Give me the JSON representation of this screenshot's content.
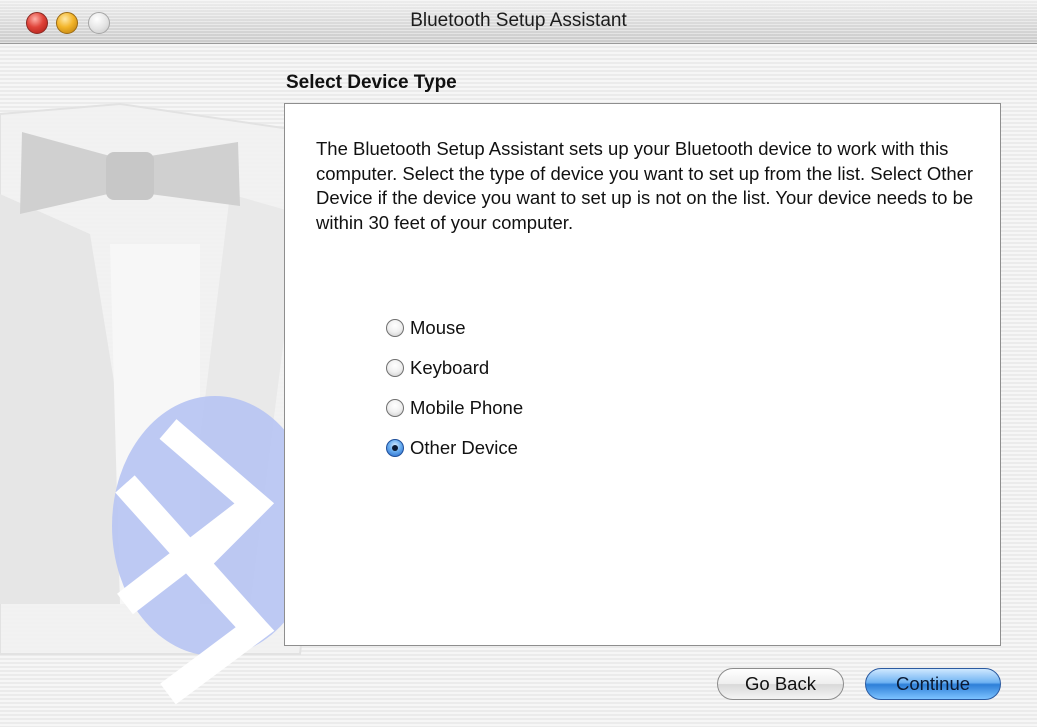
{
  "window": {
    "title": "Bluetooth Setup Assistant"
  },
  "page": {
    "heading": "Select Device Type",
    "description": "The Bluetooth Setup Assistant sets up your Bluetooth device to work with this computer. Select the type of device you want to set up from the list. Select Other Device if the device you want to set up is not on the list. Your device needs to be within 30 feet of your computer."
  },
  "options": [
    {
      "label": "Mouse",
      "selected": false
    },
    {
      "label": "Keyboard",
      "selected": false
    },
    {
      "label": "Mobile Phone",
      "selected": false
    },
    {
      "label": "Other Device",
      "selected": true
    }
  ],
  "buttons": {
    "back": "Go Back",
    "continue": "Continue"
  },
  "colors": {
    "accent_blue": "#2d7fd8",
    "bluetooth_badge": "#b9c6f2"
  },
  "icons": {
    "close": "close-icon",
    "minimize": "minimize-icon",
    "zoom": "zoom-icon",
    "bluetooth": "bluetooth-icon"
  }
}
